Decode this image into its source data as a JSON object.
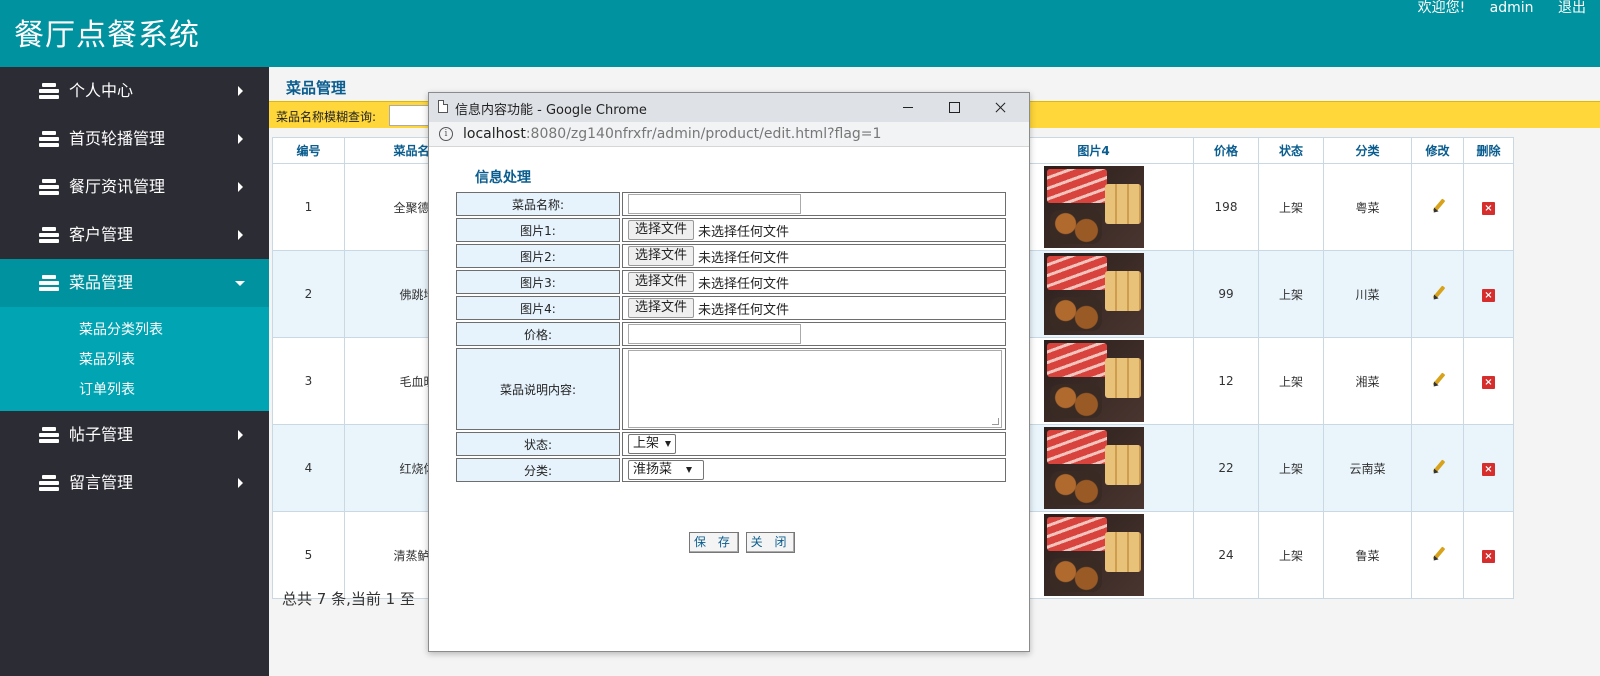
{
  "header": {
    "app_title": "餐厅点餐系统",
    "welcome": "欢迎您!",
    "username": "admin",
    "logout": "退出"
  },
  "sidebar": {
    "items": [
      {
        "label": "个人中心"
      },
      {
        "label": "首页轮播管理"
      },
      {
        "label": "餐厅资讯管理"
      },
      {
        "label": "客户管理"
      },
      {
        "label": "菜品管理"
      },
      {
        "label": "帖子管理"
      },
      {
        "label": "留言管理"
      }
    ],
    "submenu": [
      "菜品分类列表",
      "菜品列表",
      "订单列表"
    ]
  },
  "main": {
    "page_title": "菜品管理",
    "search_label": "菜品名称模糊查询:",
    "columns": {
      "id": "编号",
      "name": "菜品名称",
      "image4": "图片4",
      "price": "价格",
      "status": "状态",
      "category": "分类",
      "edit": "修改",
      "delete": "删除"
    },
    "rows": [
      {
        "id": "1",
        "name": "全聚德烤",
        "price": "198",
        "status": "上架",
        "category": "粤菜"
      },
      {
        "id": "2",
        "name": "佛跳墙",
        "price": "99",
        "status": "上架",
        "category": "川菜"
      },
      {
        "id": "3",
        "name": "毛血旺",
        "price": "12",
        "status": "上架",
        "category": "湘菜"
      },
      {
        "id": "4",
        "name": "红烧体",
        "price": "22",
        "status": "上架",
        "category": "云南菜"
      },
      {
        "id": "5",
        "name": "清蒸鲈鱼",
        "price": "24",
        "status": "上架",
        "category": "鲁菜"
      }
    ],
    "footer_count": "总共 7 条,当前 1 至"
  },
  "popup": {
    "window_title": "信息内容功能 - Google Chrome",
    "url_host": "localhost",
    "url_path": ":8080/zg140nfrxfr/admin/product/edit.html?flag=1",
    "heading": "信息处理",
    "fields": {
      "name_label": "菜品名称:",
      "image1_label": "图片1:",
      "image2_label": "图片2:",
      "image3_label": "图片3:",
      "image4_label": "图片4:",
      "price_label": "价格:",
      "desc_label": "菜品说明内容:",
      "status_label": "状态:",
      "category_label": "分类:"
    },
    "file_button": "选择文件",
    "file_status": "未选择任何文件",
    "status_value": "上架",
    "category_value": "淮扬菜",
    "save_button": "保 存",
    "close_button": "关 闭"
  }
}
